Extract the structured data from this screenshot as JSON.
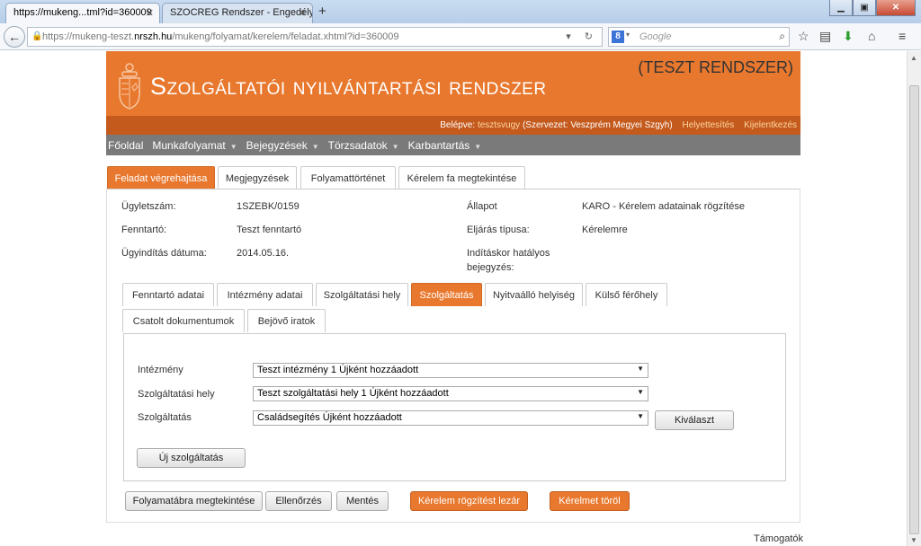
{
  "browser": {
    "tabs": [
      {
        "title": "https://mukeng...tml?id=360009",
        "close": "✕"
      },
      {
        "title": "SZOCREG Rendszer - Engedély ...",
        "close": "✕"
      }
    ],
    "new_tab": "+",
    "url_prefix": "https://mukeng-teszt.",
    "url_host": "nrszh.hu",
    "url_path": "/mukeng/folyamat/kerelem/feladat.xhtml?id=360009",
    "search_placeholder": "Google",
    "search_engine": "8"
  },
  "header": {
    "title": "Szolgáltatói nyilvántartási rendszer",
    "test_label": "(TESZT RENDSZER)"
  },
  "userbar": {
    "logged_in_label": "Belépve:",
    "username": "tesztsvugy",
    "org": "(Szervezet: Veszprém Megyei Szgyh)",
    "substitution": "Helyettesítés",
    "logout": "Kijelentkezés"
  },
  "menu": [
    {
      "label": "Főoldal",
      "caret": false
    },
    {
      "label": "Munkafolyamat",
      "caret": true
    },
    {
      "label": "Bejegyzések",
      "caret": true
    },
    {
      "label": "Törzsadatok",
      "caret": true
    },
    {
      "label": "Karbantartás",
      "caret": true
    }
  ],
  "main_tabs": [
    "Feladat végrehajtása",
    "Megjegyzések",
    "Folyamattörténet",
    "Kérelem fa megtekintése"
  ],
  "info": {
    "case_no_label": "Ügyletszám:",
    "case_no": "1SZEBK/0159",
    "status_label": "Állapot",
    "status": "KARO - Kérelem adatainak rögzítése",
    "maintainer_label": "Fenntartó:",
    "maintainer": "Teszt fenntartó",
    "procedure_label": "Eljárás típusa:",
    "procedure": "Kérelemre",
    "start_date_label": "Ügyindítás dátuma:",
    "start_date": "2014.05.16.",
    "entry_label_1": "Indításkor hatályos",
    "entry_label_2": "bejegyzés:"
  },
  "sub_tabs": [
    "Fenntartó adatai",
    "Intézmény adatai",
    "Szolgáltatási hely",
    "Szolgáltatás",
    "Nyitvaálló helyiség",
    "Külső férőhely",
    "Csatolt dokumentumok",
    "Bejövő iratok"
  ],
  "form": {
    "institution_label": "Intézmény",
    "institution_value": "Teszt intézmény 1 Újként hozzáadott",
    "site_label": "Szolgáltatási hely",
    "site_value": "Teszt szolgáltatási hely 1 Újként hozzáadott",
    "service_label": "Szolgáltatás",
    "service_value": "Családsegítés Újként hozzáadott",
    "select_button": "Kiválaszt",
    "new_service_button": "Új szolgáltatás"
  },
  "actions": [
    "Folyamatábra megtekintése",
    "Ellenőrzés",
    "Mentés",
    "Kérelem rögzítést lezár",
    "Kérelmet töröl"
  ],
  "footer": {
    "support": "Támogatók"
  },
  "colors": {
    "accent": "#e8782e",
    "accent_dark": "#c45a1c",
    "menu_bg": "#7a7a7a"
  }
}
